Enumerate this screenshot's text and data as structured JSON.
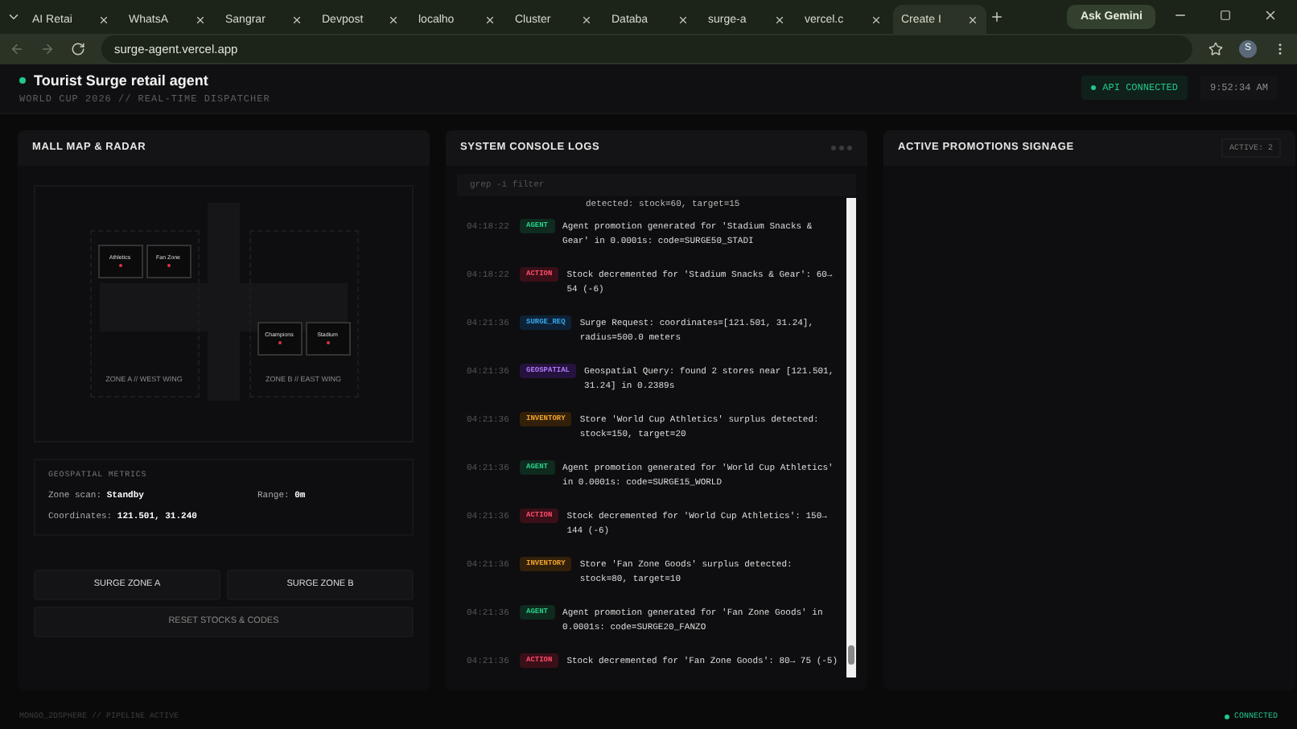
{
  "browser": {
    "tabs": [
      {
        "label": "AI Retai",
        "selected": false
      },
      {
        "label": "WhatsA",
        "selected": false
      },
      {
        "label": "Sangrar",
        "selected": false
      },
      {
        "label": "Devpost",
        "selected": false
      },
      {
        "label": "localho",
        "selected": false
      },
      {
        "label": "Cluster",
        "selected": false
      },
      {
        "label": "Databa",
        "selected": false
      },
      {
        "label": "surge-a",
        "selected": false
      },
      {
        "label": "vercel.c",
        "selected": false
      },
      {
        "label": "Create I",
        "selected": true
      }
    ],
    "gemini": "Ask Gemini",
    "address": "surge-agent.vercel.app",
    "avatar": "S"
  },
  "header": {
    "title": "Tourist Surge retail agent",
    "subtitle": "WORLD CUP 2026 // REAL-TIME DISPATCHER",
    "status": "API CONNECTED",
    "time": "9:52:34 AM"
  },
  "map_panel": {
    "title": "MALL MAP & RADAR",
    "zones": [
      {
        "label": "ZONE A // WEST WING",
        "stores": [
          "Athletics",
          "Fan Zone"
        ]
      },
      {
        "label": "ZONE B // EAST WING",
        "stores": [
          "Champions",
          "Stadium"
        ]
      }
    ],
    "metrics": {
      "title": "GEOSPATIAL METRICS",
      "zone_scan_label": "Zone scan:",
      "zone_scan": "Standby",
      "range_label": "Range:",
      "range": "0m",
      "coords_label": "Coordinates:",
      "coords": "121.501, 31.240"
    },
    "buttons": [
      "SURGE ZONE A",
      "SURGE ZONE B"
    ],
    "reset": "RESET STOCKS & CODES"
  },
  "console": {
    "title": "SYSTEM CONSOLE LOGS",
    "filter_placeholder": "grep -i filter",
    "cut_line": "detected: stock=60, target=15",
    "logs": [
      {
        "time": "04:18:22",
        "kind": "agent",
        "tag": "AGENT",
        "text": "Agent promotion generated for 'Stadium Snacks & Gear' in 0.0001s: code=SURGE50_STADI"
      },
      {
        "time": "04:18:22",
        "kind": "action",
        "tag": "ACTION",
        "text": "Stock decremented for 'Stadium Snacks & Gear': 60→ 54 (-6)"
      },
      {
        "time": "04:21:36",
        "kind": "surge",
        "tag": "SURGE_REQ",
        "text": "Surge Request: coordinates=[121.501, 31.24], radius=500.0 meters"
      },
      {
        "time": "04:21:36",
        "kind": "geo",
        "tag": "GEOSPATIAL",
        "text": "Geospatial Query: found 2 stores near [121.501, 31.24] in 0.2389s"
      },
      {
        "time": "04:21:36",
        "kind": "inventory",
        "tag": "INVENTORY",
        "text": "Store 'World Cup Athletics' surplus detected: stock=150, target=20"
      },
      {
        "time": "04:21:36",
        "kind": "agent",
        "tag": "AGENT",
        "text": "Agent promotion generated for 'World Cup Athletics' in 0.0001s: code=SURGE15_WORLD"
      },
      {
        "time": "04:21:36",
        "kind": "action",
        "tag": "ACTION",
        "text": "Stock decremented for 'World Cup Athletics': 150→ 144 (-6)"
      },
      {
        "time": "04:21:36",
        "kind": "inventory",
        "tag": "INVENTORY",
        "text": "Store 'Fan Zone Goods' surplus detected: stock=80, target=10"
      },
      {
        "time": "04:21:36",
        "kind": "agent",
        "tag": "AGENT",
        "text": "Agent promotion generated for 'Fan Zone Goods' in 0.0001s: code=SURGE20_FANZO"
      },
      {
        "time": "04:21:36",
        "kind": "action",
        "tag": "ACTION",
        "text": "Stock decremented for 'Fan Zone Goods': 80→ 75 (-5)"
      }
    ]
  },
  "promo_panel": {
    "title": "ACTIVE PROMOTIONS SIGNAGE",
    "count": "ACTIVE: 2"
  },
  "footer": {
    "left": "MONGO_2DSPHERE // PIPELINE ACTIVE",
    "right": "CONNECTED"
  }
}
